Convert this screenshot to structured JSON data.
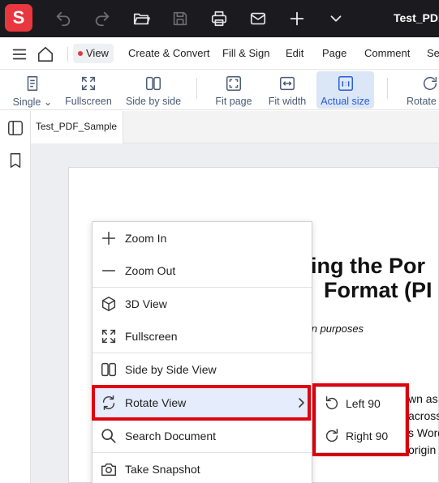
{
  "titlebar": {
    "logo_text": "S",
    "doc_title": "Test_PDF",
    "icons": [
      "undo-icon",
      "redo-icon",
      "open-folder-icon",
      "save-icon",
      "print-icon",
      "mail-icon",
      "add-icon",
      "chevron-down-icon"
    ],
    "brand_color": "#e8373f",
    "background": "#1b1b1f"
  },
  "menubar": {
    "icons": [
      "hamburger-menu-icon",
      "home-icon"
    ],
    "tabs": [
      {
        "label": "View",
        "active": true
      },
      {
        "label": "Create & Convert"
      },
      {
        "label": "Fill & Sign"
      },
      {
        "label": "Edit"
      },
      {
        "label": "Page"
      },
      {
        "label": "Comment"
      },
      {
        "label": "Se"
      }
    ]
  },
  "toolbar": {
    "tools": [
      {
        "label": "Single ⌄",
        "icon": "single-page-icon"
      },
      {
        "label": "Fullscreen",
        "icon": "fullscreen-icon"
      },
      {
        "label": "Side by side",
        "icon": "side-by-side-icon"
      },
      {
        "label": "Fit page",
        "icon": "fit-page-icon"
      },
      {
        "label": "Fit width",
        "icon": "fit-width-icon"
      },
      {
        "label": "Actual size",
        "icon": "actual-size-icon",
        "active": true
      },
      {
        "label": "Rotate v",
        "icon": "rotate-view-icon"
      }
    ],
    "accent_color": "#2a5bd7"
  },
  "sidepanel": {
    "icons": [
      "panel-toggle-icon",
      "bookmark-icon"
    ]
  },
  "tabs": {
    "doc_tab": "Test_PDF_Sample"
  },
  "document": {
    "heading_line1": "ing the Por",
    "heading_line2": "Format (PI",
    "subtitle": "tion purposes",
    "body_lines": [
      "wn as I",
      "across",
      "s Word",
      "origin"
    ]
  },
  "context_menu": {
    "items": [
      {
        "label": "Zoom In",
        "icon": "plus-icon"
      },
      {
        "label": "Zoom Out",
        "icon": "minus-icon"
      },
      {
        "label": "3D View",
        "icon": "cube-icon"
      },
      {
        "label": "Fullscreen",
        "icon": "fullscreen-icon"
      },
      {
        "label": "Side by Side View",
        "icon": "side-by-side-icon"
      },
      {
        "label": "Rotate View",
        "icon": "rotate-icon",
        "highlighted": true,
        "has_submenu": true
      },
      {
        "label": "Search Document",
        "icon": "search-icon"
      },
      {
        "label": "Take Snapshot",
        "icon": "camera-icon"
      }
    ],
    "submenu": [
      {
        "label": "Left 90",
        "icon": "rotate-left-icon"
      },
      {
        "label": "Right 90",
        "icon": "rotate-right-icon"
      }
    ],
    "highlight_outline_color": "#e3000f"
  }
}
